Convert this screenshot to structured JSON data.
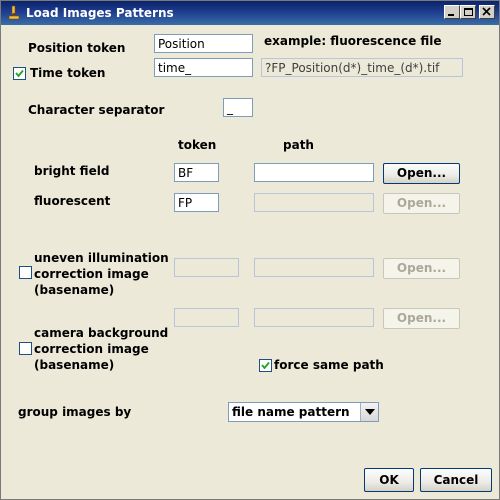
{
  "window": {
    "title": "Load Images Patterns",
    "icon": "microscope-icon"
  },
  "position_token": {
    "label": "Position token",
    "value": "Position"
  },
  "example": {
    "label": "example: fluorescence file",
    "value": "?FP_Position(d*)_time_(d*).tif"
  },
  "time_token": {
    "label": "Time token",
    "value": "time_",
    "checked": true
  },
  "char_separator": {
    "label": "Character separator",
    "value": "_"
  },
  "columns": {
    "token": "token",
    "path": "path"
  },
  "bright_field": {
    "label": "bright field",
    "token": "BF",
    "path": "",
    "button": "Open..."
  },
  "fluorescent": {
    "label": "fluorescent",
    "token": "FP",
    "path": "",
    "button": "Open..."
  },
  "uneven": {
    "label_line1": "uneven illumination",
    "label_line2": "correction image",
    "label_line3": "(basename)",
    "checked": false,
    "token": "",
    "path": "",
    "button": "Open..."
  },
  "camera": {
    "label_line1": "camera background",
    "label_line2": "correction image",
    "label_line3": "(basename)",
    "checked": false,
    "token": "",
    "path": "",
    "button": "Open..."
  },
  "force_same_path": {
    "label": "force same path",
    "checked": true
  },
  "group_by": {
    "label": "group images by",
    "value": "file name pattern"
  },
  "footer": {
    "ok": "OK",
    "cancel": "Cancel"
  }
}
